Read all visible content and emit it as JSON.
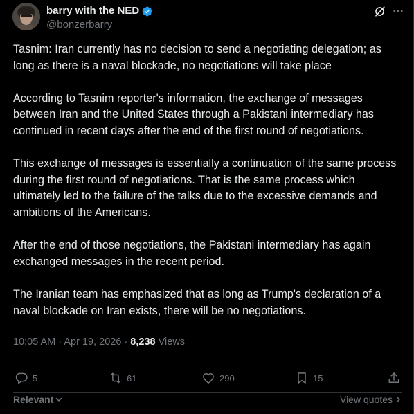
{
  "author": {
    "display_name": "barry with the NED",
    "handle": "@bonzerbarry",
    "verified": true
  },
  "tweet": {
    "paragraphs": [
      "Tasnim: Iran currently has no decision to send a negotiating delegation; as long as there is a naval blockade, no negotiations will take place",
      "According to Tasnim reporter's information, the exchange of messages between Iran and the United States through a Pakistani intermediary has continued in recent days after the end of the first round of negotiations.",
      "This exchange of messages is essentially a continuation of the same process during the first round of negotiations. That is the same process which ultimately led to the failure of the talks due to the excessive demands and ambitions of the Americans.",
      "After the end of those negotiations, the Pakistani intermediary has again exchanged messages in the recent period.",
      "The Iranian team has emphasized that as long as Trump's declaration of a naval blockade on Iran exists, there will be no negotiations."
    ],
    "time": "10:05 AM",
    "date": "Apr 19, 2026",
    "views_count": "8,238",
    "views_label": "Views"
  },
  "actions": {
    "replies": "5",
    "reposts": "61",
    "likes": "290",
    "bookmarks": "15"
  },
  "footer": {
    "relevant_label": "Relevant",
    "view_quotes_label": "View quotes"
  },
  "colors": {
    "background": "#000000",
    "text": "#e7e9ea",
    "muted": "#71767b",
    "verified": "#1d9bf0",
    "divider": "#2f3336"
  }
}
